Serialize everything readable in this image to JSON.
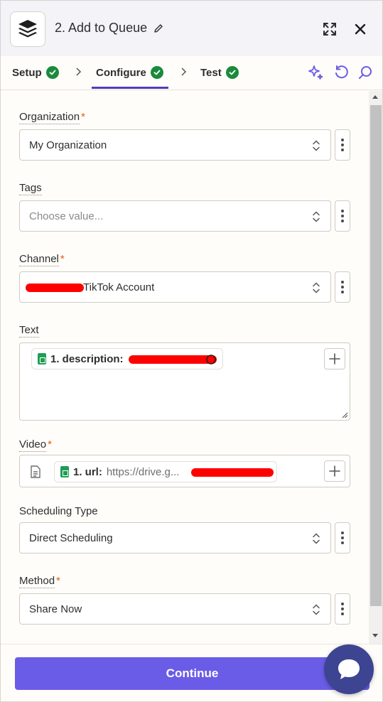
{
  "header": {
    "step_title": "2. Add to Queue",
    "icons": [
      "buffer-app-icon",
      "pencil-icon",
      "expand-icon",
      "close-icon"
    ]
  },
  "tabs": [
    {
      "label": "Setup",
      "status": "complete"
    },
    {
      "label": "Configure",
      "status": "complete",
      "active": true
    },
    {
      "label": "Test",
      "status": "complete"
    }
  ],
  "toolbar": {
    "icons": [
      "sparkle-icon",
      "undo-icon",
      "search-icon"
    ]
  },
  "form": {
    "organization": {
      "label": "Organization",
      "required": "*",
      "value": "My Organization"
    },
    "tags": {
      "label": "Tags",
      "placeholder": "Choose value..."
    },
    "channel": {
      "label": "Channel",
      "required": "*",
      "value": "TikTok Account"
    },
    "text": {
      "label": "Text",
      "pill_key": "1. description:"
    },
    "video": {
      "label": "Video",
      "required": "*",
      "pill_key": "1. url:",
      "pill_value": "https://drive.g..."
    },
    "scheduling_type": {
      "label": "Scheduling Type",
      "value": "Direct Scheduling"
    },
    "method": {
      "label": "Method",
      "required": "*",
      "value": "Share Now"
    }
  },
  "footer": {
    "continue_label": "Continue"
  },
  "colors": {
    "accent": "#6b5ce7",
    "check_green": "#1b8a3c",
    "required": "#e8590c",
    "chat": "#3d4592"
  }
}
